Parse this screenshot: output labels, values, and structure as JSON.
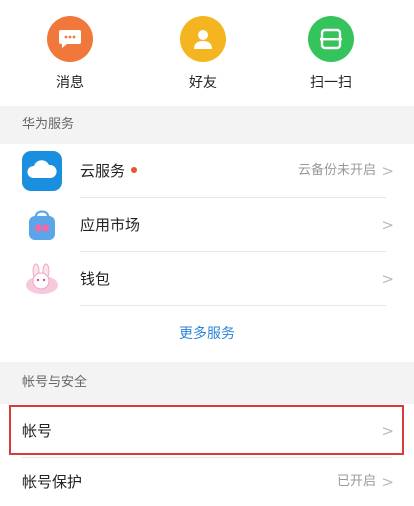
{
  "quick_actions": [
    {
      "label": "消息",
      "icon": "message-icon",
      "color": "#f0783a"
    },
    {
      "label": "好友",
      "icon": "friend-icon",
      "color": "#f5b521"
    },
    {
      "label": "扫一扫",
      "icon": "scan-icon",
      "color": "#35c35b"
    }
  ],
  "huawei_services": {
    "header": "华为服务",
    "items": [
      {
        "title": "云服务",
        "value": "云备份未开启",
        "icon": "cloud-service-icon",
        "has_badge": true
      },
      {
        "title": "应用市场",
        "value": "",
        "icon": "app-market-icon"
      },
      {
        "title": "钱包",
        "value": "",
        "icon": "wallet-icon"
      }
    ],
    "more": "更多服务"
  },
  "account_security": {
    "header": "帐号与安全",
    "items": [
      {
        "title": "帐号",
        "value": ""
      },
      {
        "title": "帐号保护",
        "value": "已开启"
      }
    ]
  },
  "chevron": ">",
  "colors": {
    "link": "#2c86d8",
    "badge": "#e4572e",
    "highlight": "#d93a3a"
  }
}
